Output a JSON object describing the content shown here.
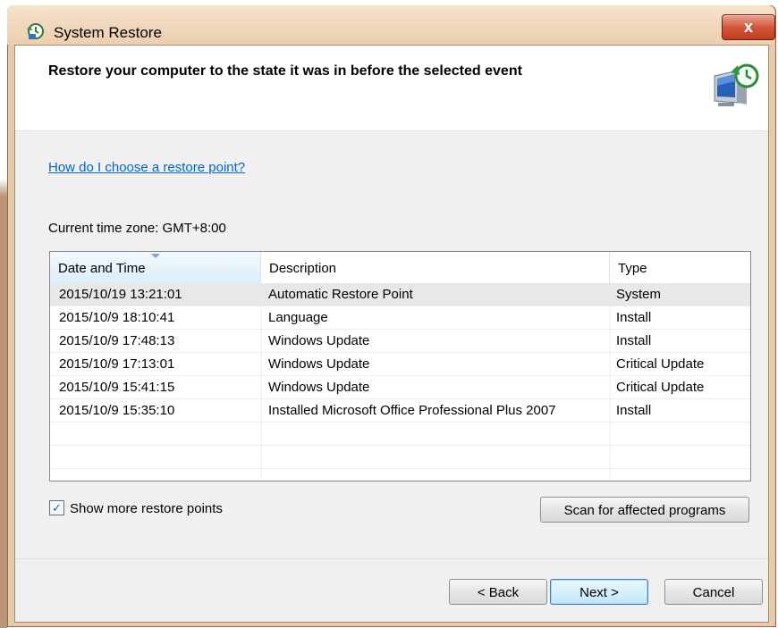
{
  "window": {
    "title": "System Restore",
    "close_label": "x"
  },
  "header": {
    "heading": "Restore your computer to the state it was in before the selected event"
  },
  "help_link": "How do I choose a restore point?",
  "timezone": "Current time zone: GMT+8:00",
  "table": {
    "columns": [
      "Date and Time",
      "Description",
      "Type"
    ],
    "rows": [
      {
        "date": "2015/10/19 13:21:01",
        "description": "Automatic Restore Point",
        "type": "System"
      },
      {
        "date": "2015/10/9 18:10:41",
        "description": "Language",
        "type": "Install"
      },
      {
        "date": "2015/10/9 17:48:13",
        "description": "Windows Update",
        "type": "Install"
      },
      {
        "date": "2015/10/9 17:13:01",
        "description": "Windows Update",
        "type": "Critical Update"
      },
      {
        "date": "2015/10/9 15:41:15",
        "description": "Windows Update",
        "type": "Critical Update"
      },
      {
        "date": "2015/10/9 15:35:10",
        "description": "Installed Microsoft Office Professional Plus 2007",
        "type": "Install"
      }
    ],
    "selected_row": 0
  },
  "show_more": {
    "label": "Show more restore points",
    "checked": true,
    "check_glyph": "✓"
  },
  "buttons": {
    "scan": "Scan for affected programs",
    "back": "< Back",
    "next": "Next >",
    "cancel": "Cancel"
  },
  "colors": {
    "link": "#0066cc",
    "title_bar": "#eccfae",
    "close_button": "#c23a1f",
    "selected_row": "#e8e8e8"
  },
  "icons": [
    "system-restore-icon",
    "close-icon",
    "restore-monitor-icon",
    "sort-arrow-icon",
    "checkmark-icon"
  ]
}
